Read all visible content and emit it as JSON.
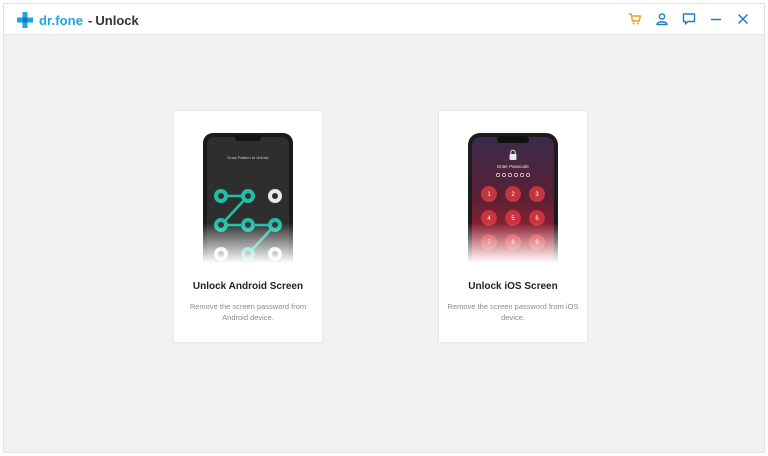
{
  "app": {
    "brand": "dr.fone",
    "separator": "-",
    "module": "Unlock"
  },
  "titlebar": {
    "icons": [
      "cart-icon",
      "user-icon",
      "feedback-icon",
      "minimize-icon",
      "close-icon"
    ],
    "cart_color": "#f29b1d",
    "accent_color": "#1fa5e6"
  },
  "cards": [
    {
      "id": "android",
      "title": "Unlock Android Screen",
      "description": "Remove the screen password from Android device.",
      "screen_text": "Draw Pattern to Unlock"
    },
    {
      "id": "ios",
      "title": "Unlock iOS Screen",
      "description": "Remove the screen password from iOS device.",
      "screen_text": "Enter Passcode",
      "keypad": [
        "1",
        "2",
        "3",
        "4",
        "5",
        "6",
        "7",
        "8",
        "9"
      ]
    }
  ]
}
